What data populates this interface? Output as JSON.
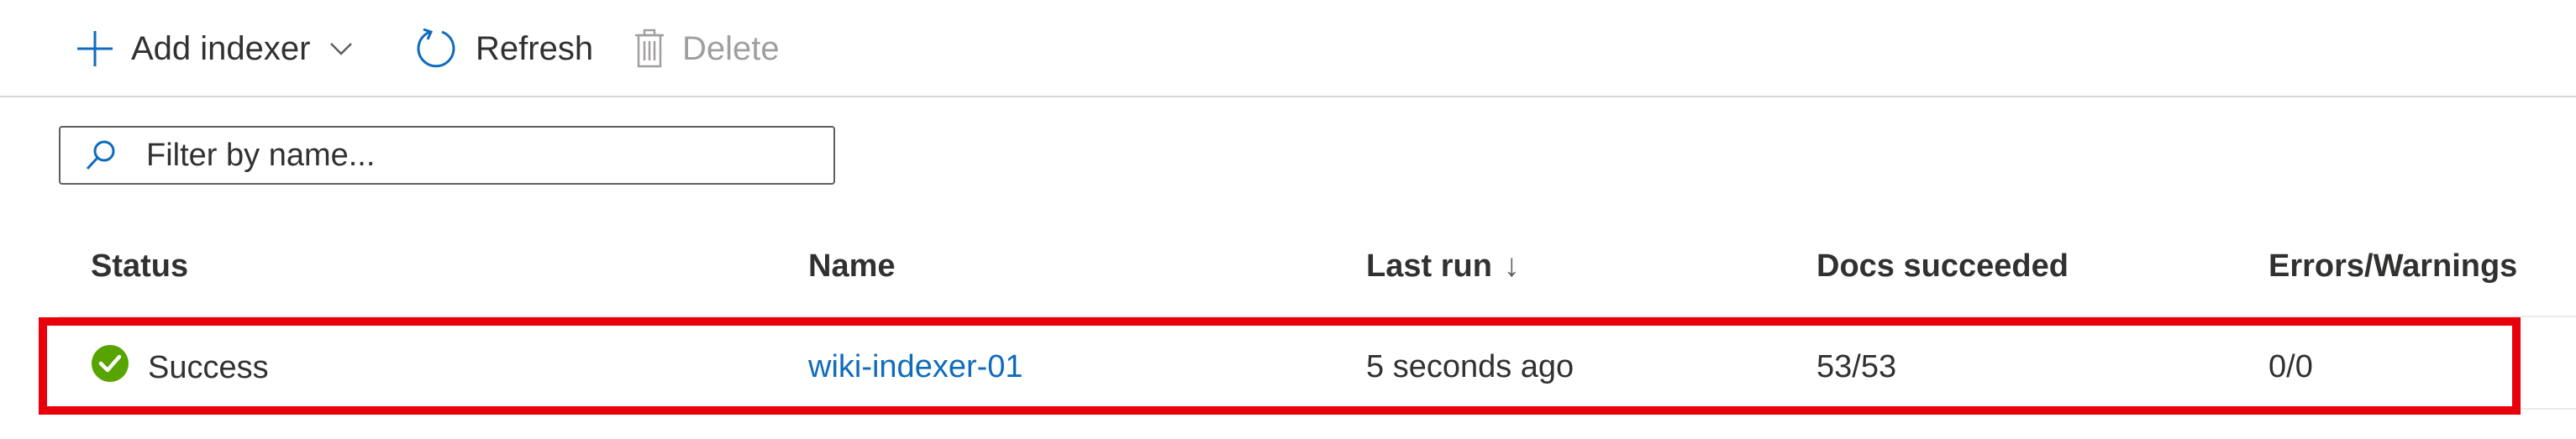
{
  "toolbar": {
    "add_label": "Add indexer",
    "refresh_label": "Refresh",
    "delete_label": "Delete",
    "icons": {
      "add": "plus-icon",
      "add_dropdown": "chevron-down-icon",
      "refresh": "refresh-icon",
      "delete": "trash-icon"
    }
  },
  "filter": {
    "placeholder": "Filter by name...",
    "value": "",
    "icon": "search-icon"
  },
  "table": {
    "columns": {
      "status": "Status",
      "name": "Name",
      "last_run": "Last run",
      "last_run_sort": "↓",
      "docs": "Docs succeeded",
      "errors": "Errors/Warnings"
    },
    "rows": [
      {
        "status": "Success",
        "status_icon": "success-check-icon",
        "name": "wiki-indexer-01",
        "last_run": "5 seconds ago",
        "docs": "53/53",
        "errors": "0/0"
      }
    ]
  },
  "colors": {
    "accent": "#0f6cbd",
    "success": "#57a300",
    "highlight": "#e8000b",
    "disabled": "#a19f9d"
  }
}
